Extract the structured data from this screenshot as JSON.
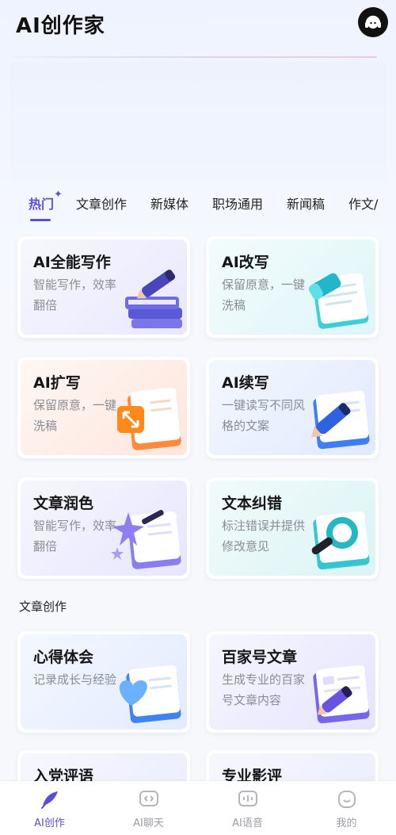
{
  "header": {
    "title": "AI创作家",
    "support_icon": "headset-icon"
  },
  "tabs": [
    {
      "label": "热门",
      "active": true
    },
    {
      "label": "文章创作"
    },
    {
      "label": "新媒体"
    },
    {
      "label": "职场通用"
    },
    {
      "label": "新闻稿"
    },
    {
      "label": "作文/"
    }
  ],
  "hot_cards": [
    {
      "title": "AI全能写作",
      "desc": "智能写作，效率翻倍",
      "icon": "books-pen-icon"
    },
    {
      "title": "AI改写",
      "desc": "保留原意，一键洗稿",
      "icon": "notebook-eraser-icon"
    },
    {
      "title": "AI扩写",
      "desc": "保留原意，一键洗稿",
      "icon": "expand-note-icon"
    },
    {
      "title": "AI续写",
      "desc": "一键读写不同风格的文案",
      "icon": "pen-paper-icon"
    },
    {
      "title": "文章润色",
      "desc": "智能写作，效率翻倍",
      "icon": "star-wand-icon"
    },
    {
      "title": "文本纠错",
      "desc": "标注错误并提供修改意见",
      "icon": "magnifier-icon"
    }
  ],
  "section": {
    "title": "文章创作"
  },
  "article_cards": [
    {
      "title": "心得体会",
      "desc": "记录成长与经验",
      "icon": "heart-note-icon"
    },
    {
      "title": "百家号文章",
      "desc": "生成专业的百家号文章内容",
      "icon": "article-pen-icon"
    },
    {
      "title": "入党评语"
    },
    {
      "title": "专业影评"
    }
  ],
  "bottom_nav": [
    {
      "label": "AI创作",
      "icon": "quill-icon",
      "active": true
    },
    {
      "label": "AI聊天",
      "icon": "chat-icon"
    },
    {
      "label": "AI语音",
      "icon": "voice-icon"
    },
    {
      "label": "我的",
      "icon": "profile-icon"
    }
  ],
  "colors": {
    "accent": "#5b4fd8",
    "muted_text": "#8a8c96"
  }
}
